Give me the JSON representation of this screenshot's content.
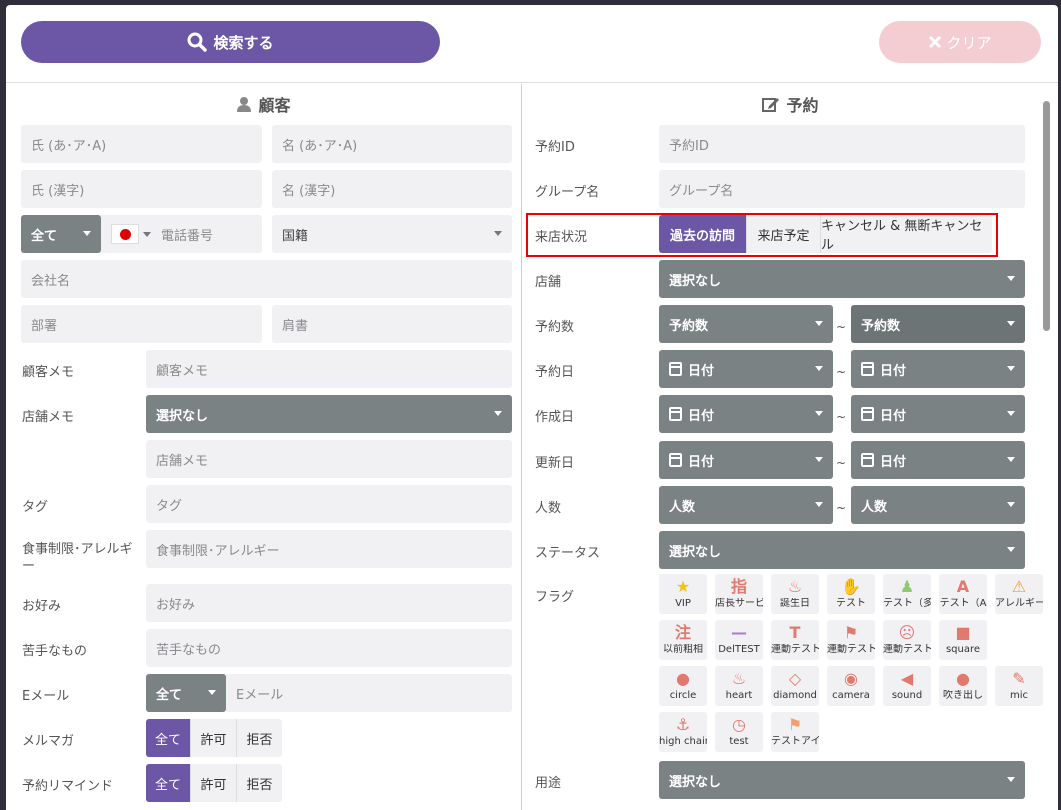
{
  "toolbar": {
    "search_label": "検索する",
    "clear_label": "クリア"
  },
  "customer": {
    "title": "顧客",
    "last_kana": "氏 (あ･ア･A)",
    "first_kana": "名 (あ･ア･A)",
    "last_kanji": "氏 (漢字)",
    "first_kanji": "名 (漢字)",
    "phone_scope": "全て",
    "phone_placeholder": "電話番号",
    "nationality": "国籍",
    "company": "会社名",
    "department": "部署",
    "position": "肩書",
    "memo_label": "顧客メモ",
    "memo_placeholder": "顧客メモ",
    "store_memo_label": "店舗メモ",
    "store_memo_select": "選択なし",
    "store_memo_placeholder": "店舗メモ",
    "tag_label": "タグ",
    "tag_placeholder": "タグ",
    "diet_label": "食事制限･アレルギー",
    "diet_placeholder": "食事制限･アレルギー",
    "like_label": "お好み",
    "like_placeholder": "お好み",
    "dislike_label": "苦手なもの",
    "dislike_placeholder": "苦手なもの",
    "email_label": "Eメール",
    "email_scope": "全て",
    "email_placeholder": "Eメール",
    "newsletter_label": "メルマガ",
    "newsletter_options": [
      "全て",
      "許可",
      "拒否"
    ],
    "remind_label": "予約リマインド",
    "remind_options": [
      "全て",
      "許可",
      "拒否"
    ]
  },
  "reservation": {
    "title": "予約",
    "id_label": "予約ID",
    "id_placeholder": "予約ID",
    "group_label": "グループ名",
    "group_placeholder": "グループ名",
    "visit_label": "来店状況",
    "visit_options": [
      "過去の訪問",
      "来店予定",
      "キャンセル & 無断キャンセル"
    ],
    "store_label": "店舗",
    "store_select": "選択なし",
    "count_label": "予約数",
    "count_from": "予約数",
    "count_to": "予約数",
    "date_label": "予約日",
    "created_label": "作成日",
    "updated_label": "更新日",
    "date_placeholder": "日付",
    "people_label": "人数",
    "people_from": "人数",
    "people_to": "人数",
    "tilde": "~",
    "status_label": "ステータス",
    "status_select": "選択なし",
    "flag_label": "フラグ",
    "flags": [
      "VIP",
      "店長サービス",
      "誕生日",
      "テスト",
      "テスト（多",
      "テスト（A",
      "アレルギー",
      "以前粗相",
      "DelTEST",
      "連動テスト",
      "連動テスト",
      "連動テスト",
      "square",
      "circle",
      "heart",
      "diamond",
      "camera",
      "sound",
      "吹き出し",
      "mic",
      "high chair",
      "test",
      "テストアイ"
    ],
    "flag_glyphs": [
      "★",
      "指",
      "♨",
      "✋",
      "♟",
      "A",
      "⚠",
      "注",
      "—",
      "T",
      "⚑",
      "☹",
      "■",
      "●",
      "♨",
      "◇",
      "◉",
      "◀",
      "●",
      "✎",
      "⚓",
      "◷",
      "⚑"
    ],
    "usage_label": "用途",
    "usage_select": "選択なし"
  },
  "colors": {
    "accent": "#6b57a5",
    "dropdown": "#7a8284",
    "clear": "#f4cdd2",
    "highlight": "#ee0000"
  }
}
